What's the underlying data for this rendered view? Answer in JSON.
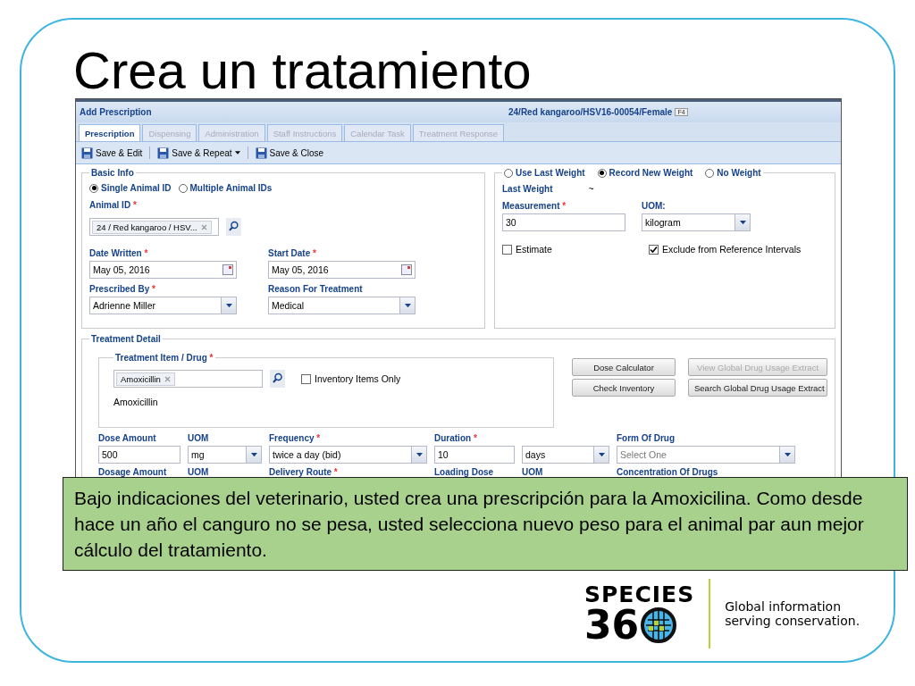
{
  "slide": {
    "title": "Crea un tratamiento",
    "callout": "Bajo indicaciones del veterinario, usted crea una prescripción para la Amoxicilina.  Como desde hace un año el canguro no se pesa, usted selecciona nuevo peso para el animal par aun mejor cálculo del tratamiento.",
    "logo": {
      "word": "SPECIES",
      "number": "36",
      "tagline": [
        "Global information",
        "serving conservation."
      ]
    }
  },
  "app": {
    "title": "Add Prescription",
    "record": "24/Red kangaroo/HSV16-00054/Female",
    "record_key": "F4",
    "tabs": [
      {
        "label": "Prescription",
        "selected": true
      },
      {
        "label": "Dispensing",
        "selected": false
      },
      {
        "label": "Administration",
        "selected": false
      },
      {
        "label": "Staff Instructions",
        "selected": false
      },
      {
        "label": "Calendar Task",
        "selected": false
      },
      {
        "label": "Treatment Response",
        "selected": false
      }
    ],
    "toolbar": [
      {
        "label": "Save & Edit",
        "dropdown": false
      },
      {
        "label": "Save & Repeat",
        "dropdown": true
      },
      {
        "label": "Save & Close",
        "dropdown": false
      }
    ],
    "basic_info": {
      "legend": "Basic Info",
      "id_mode": [
        {
          "label": "Single Animal ID",
          "selected": true
        },
        {
          "label": "Multiple Animal IDs",
          "selected": false
        }
      ],
      "animal_id": {
        "label": "Animal ID",
        "mark": "*",
        "tag": "24 / Red kangaroo / HSV..."
      },
      "fields": [
        {
          "kind": "date",
          "label": "Date Written",
          "mark": "*",
          "value": "May 05, 2016"
        },
        {
          "kind": "date",
          "label": "Start Date",
          "mark": "*",
          "value": "May 05, 2016"
        },
        {
          "kind": "select",
          "label": "Prescribed By",
          "mark": "*",
          "value": "Adrienne Miller"
        },
        {
          "kind": "select",
          "label": "Reason For Treatment",
          "value": "Medical"
        }
      ]
    },
    "weight": {
      "options": [
        {
          "label": "Use Last Weight",
          "selected": false
        },
        {
          "label": "Record New Weight",
          "selected": true
        },
        {
          "label": "No Weight",
          "selected": false
        }
      ],
      "last_weight_label": "Last Weight",
      "last_weight_value": "~",
      "fields": [
        {
          "kind": "text",
          "label": "Measurement",
          "mark": "*",
          "value": "30"
        },
        {
          "kind": "select",
          "label": "UOM:",
          "value": "kilogram"
        }
      ],
      "checks": [
        {
          "label": "Estimate",
          "checked": false
        },
        {
          "label": "Exclude from Reference Intervals",
          "checked": true
        }
      ]
    },
    "treatment": {
      "legend": "Treatment Detail",
      "item_legend": "Treatment Item / Drug",
      "item_mark": "*",
      "item_tag": "Amoxicillin",
      "inventory_only": {
        "label": "Inventory Items Only",
        "checked": false
      },
      "item_name": "Amoxicillin",
      "buttons": [
        {
          "label": "Dose Calculator",
          "disabled": false
        },
        {
          "label": "View Global Drug Usage Extract",
          "disabled": true
        },
        {
          "label": "Check Inventory",
          "disabled": false
        },
        {
          "label": "Search Global Drug Usage Extract",
          "disabled": false
        }
      ],
      "fields": [
        {
          "kind": "text",
          "label": "Dose Amount",
          "value": "500"
        },
        {
          "kind": "select",
          "label": "UOM",
          "value": "mg"
        },
        {
          "kind": "select",
          "label": "Frequency",
          "mark": "*",
          "value": "twice a day (bid)"
        },
        {
          "kind": "text",
          "label": "Duration",
          "mark": "*",
          "value": "10"
        },
        {
          "kind": "select",
          "value": "days"
        },
        {
          "kind": "select",
          "label": "Form Of Drug",
          "placeholder": "Select One"
        }
      ],
      "next_row": [
        {
          "label": "Dosage Amount"
        },
        {
          "label": "UOM"
        },
        {
          "label": "Delivery Route",
          "mark": "*"
        },
        {
          "label": "Loading Dose"
        },
        {
          "label": "UOM"
        },
        {
          "label": "Concentration Of Drugs"
        }
      ]
    }
  }
}
